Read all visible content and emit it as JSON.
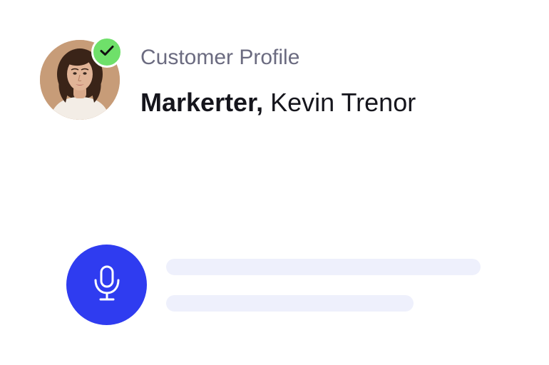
{
  "profile": {
    "label": "Customer Profile",
    "role": "Markerter,",
    "name": " Kevin Trenor",
    "verified": true,
    "badge_color": "#6fe06a"
  },
  "voice": {
    "icon": "microphone-icon",
    "button_color": "#2f3cf0"
  },
  "placeholder_color": "#eef0fc"
}
